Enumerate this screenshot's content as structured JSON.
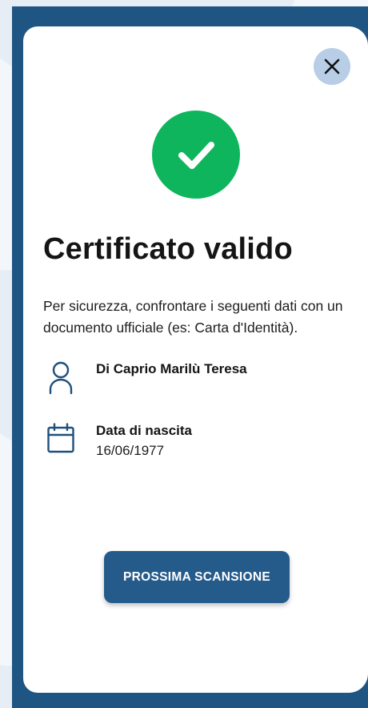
{
  "certificate": {
    "status_title": "Certificato valido",
    "instructions": "Per sicurezza, confrontare i seguenti dati con un documento ufficiale (es: Carta d'Identità).",
    "holder_name": "Di Caprio Marilù Teresa",
    "birth_date_label": "Data di nascita",
    "birth_date": "16/06/1977"
  },
  "actions": {
    "next_scan_label": "PROSSIMA SCANSIONE"
  },
  "icons": {
    "close": "close-icon",
    "status": "checkmark-icon",
    "person": "person-icon",
    "calendar": "calendar-icon"
  },
  "colors": {
    "modal_frame": "#1f5583",
    "success": "#0fb55d",
    "primary_button": "#255b8b",
    "close_button": "#b8cde6"
  }
}
